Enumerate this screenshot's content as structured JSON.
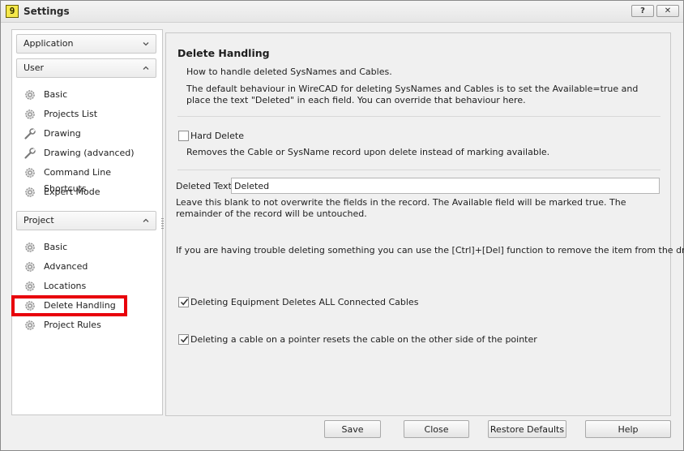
{
  "window": {
    "title": "Settings",
    "app_icon_text": "9",
    "help_button": "?",
    "close_button": "✕"
  },
  "sidebar": {
    "groups": [
      {
        "label": "Application",
        "state": "collapsed",
        "items": []
      },
      {
        "label": "User",
        "state": "expanded",
        "items": [
          "Basic",
          "Projects List",
          "Drawing",
          "Drawing (advanced)",
          "Command Line Shortcuts",
          "Expert Mode"
        ]
      },
      {
        "label": "Project",
        "state": "expanded",
        "items": [
          "Basic",
          "Advanced",
          "Locations",
          "Delete Handling",
          "Project Rules"
        ]
      }
    ],
    "selected": "Delete Handling"
  },
  "content": {
    "heading": "Delete Handling",
    "intro": "How to handle deleted SysNames and Cables.",
    "default_behaviour": "The default behaviour in WireCAD for deleting SysNames and Cables is to set the Available=true and place the text \"Deleted\" in each field. You can override that behaviour here.",
    "hard_delete": {
      "label": "Hard Delete",
      "checked": false,
      "description": "Removes the Cable or SysName record upon delete instead of marking available."
    },
    "deleted_text": {
      "label": "Deleted Text",
      "value": "Deleted",
      "description": "Leave this blank to not overwrite the fields in the record. The Available field will be marked true. The remainder of the record will be untouched."
    },
    "trouble_note": "If you are having trouble deleting something you can use the [Ctrl]+[Del] function to remove the item from the drawing",
    "equipment_cascade": {
      "label": "Deleting Equipment Deletes ALL Connected Cables",
      "checked": true
    },
    "pointer_reset": {
      "label": "Deleting a cable on a pointer resets the cable on the other side of the pointer",
      "checked": true
    }
  },
  "footer": {
    "save": "Save",
    "close": "Close",
    "restore_defaults": "Restore Defaults",
    "help": "Help"
  },
  "colors": {
    "highlight": "#e8000b",
    "window_bg": "#f0f0f0"
  },
  "icons": {
    "nav_default": "gear-icon",
    "nav_drawing": "wrench-icon"
  }
}
